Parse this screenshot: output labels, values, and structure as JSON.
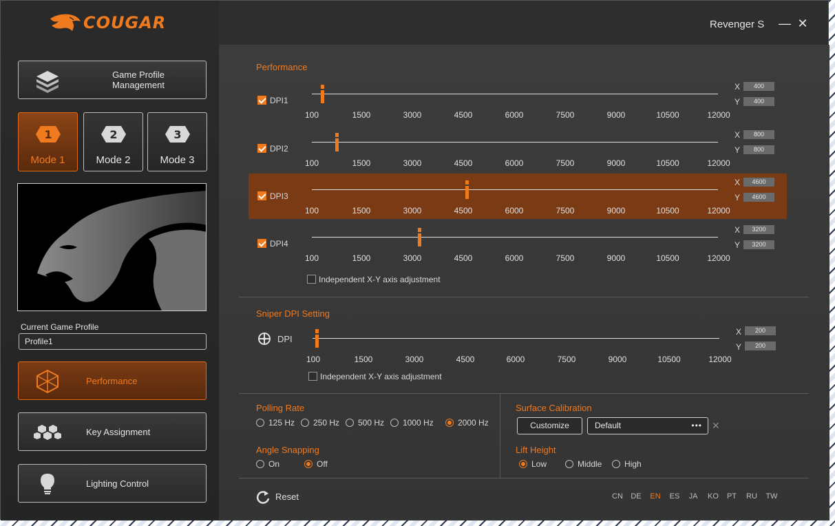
{
  "window": {
    "title": "Revenger S",
    "minimize_icon": "—",
    "close_icon": "✕"
  },
  "brand": {
    "logo_text": "COUGAR",
    "accent": "#f07a1e"
  },
  "sidebar": {
    "game_profile_button": "Game Profile Management",
    "modes": [
      {
        "number": "1",
        "label": "Mode 1",
        "active": true
      },
      {
        "number": "2",
        "label": "Mode 2",
        "active": false
      },
      {
        "number": "3",
        "label": "Mode 3",
        "active": false
      }
    ],
    "current_profile_label": "Current Game Profile",
    "current_profile_value": "Profile1",
    "nav": [
      {
        "label": "Performance",
        "icon": "hexagon-cube-icon",
        "active": true
      },
      {
        "label": "Key Assignment",
        "icon": "honeycomb-icon",
        "active": false
      },
      {
        "label": "Lighting Control",
        "icon": "lightbulb-icon",
        "active": false
      }
    ]
  },
  "performance": {
    "title": "Performance",
    "ticks": [
      "100",
      "1500",
      "3000",
      "4500",
      "6000",
      "7500",
      "9000",
      "10500",
      "12000"
    ],
    "dpi_min": 100,
    "dpi_max": 12000,
    "rows": [
      {
        "label": "DPI1",
        "checked": true,
        "x": "400",
        "y": "400",
        "value": 400,
        "highlighted": false
      },
      {
        "label": "DPI2",
        "checked": true,
        "x": "800",
        "y": "800",
        "value": 800,
        "highlighted": false
      },
      {
        "label": "DPI3",
        "checked": true,
        "x": "4600",
        "y": "4600",
        "value": 4600,
        "highlighted": true
      },
      {
        "label": "DPI4",
        "checked": true,
        "x": "3200",
        "y": "3200",
        "value": 3200,
        "highlighted": false
      }
    ],
    "independent_label": "Independent X-Y axis adjustment",
    "independent_checked": false,
    "x_label": "X",
    "y_label": "Y"
  },
  "sniper": {
    "title": "Sniper DPI Setting",
    "dpi_label": "DPI",
    "x": "200",
    "y": "200",
    "value": 200,
    "independent_label": "Independent X-Y axis adjustment",
    "independent_checked": false
  },
  "polling": {
    "title": "Polling Rate",
    "options": [
      "125 Hz",
      "250 Hz",
      "500 Hz",
      "1000 Hz",
      "2000 Hz"
    ],
    "selected": "2000 Hz"
  },
  "angle_snapping": {
    "title": "Angle Snapping",
    "options": [
      "On",
      "Off"
    ],
    "selected": "Off"
  },
  "surface": {
    "title": "Surface Calibration",
    "customize_label": "Customize",
    "value": "Default",
    "more_icon": "•••",
    "clear_icon": "✕"
  },
  "lift_height": {
    "title": "Lift Height",
    "options": [
      "Low",
      "Middle",
      "High"
    ],
    "selected": "Low"
  },
  "footer": {
    "reset_label": "Reset",
    "languages": [
      "CN",
      "DE",
      "EN",
      "ES",
      "JA",
      "KO",
      "PT",
      "RU",
      "TW"
    ],
    "active_language": "EN"
  }
}
